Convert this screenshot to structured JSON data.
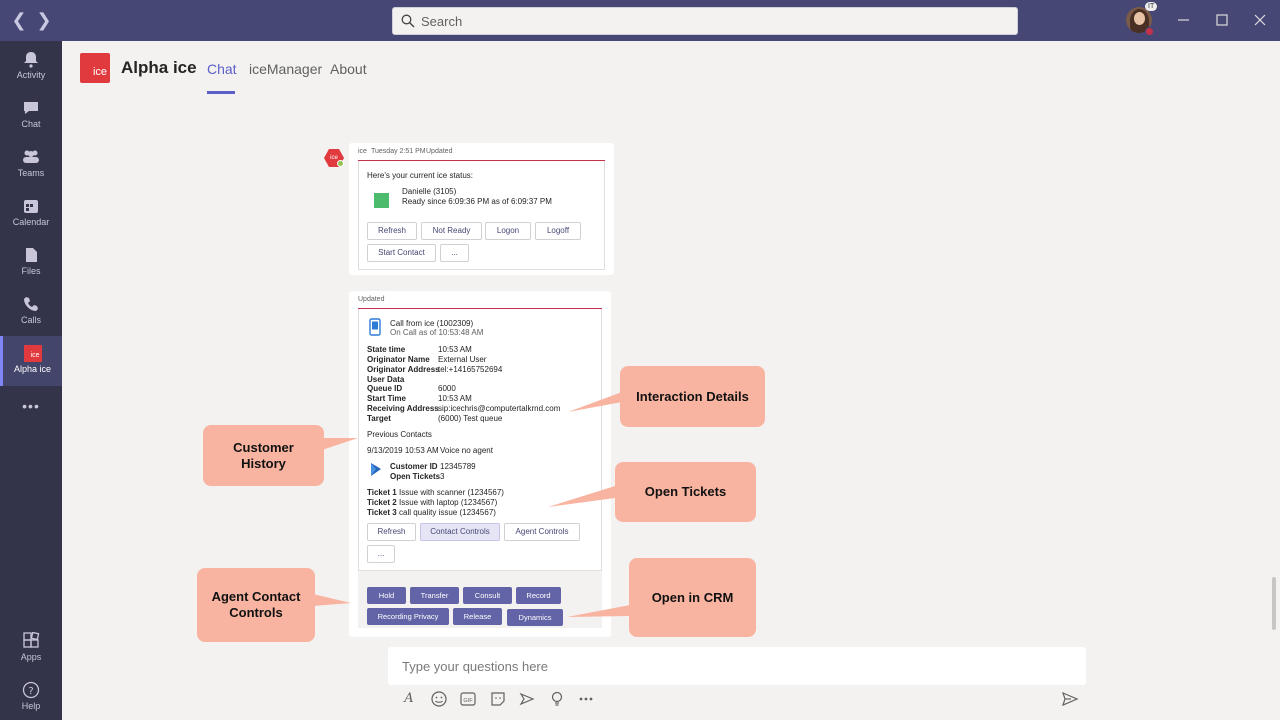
{
  "titlebar": {
    "back_glyph": "❮",
    "forward_glyph": "❯",
    "search_placeholder": "Search",
    "avatar_badge": "IT"
  },
  "rail": {
    "items": [
      {
        "label": "Activity",
        "icon": "bell-icon"
      },
      {
        "label": "Chat",
        "icon": "chat-icon"
      },
      {
        "label": "Teams",
        "icon": "teams-icon"
      },
      {
        "label": "Calendar",
        "icon": "calendar-icon"
      },
      {
        "label": "Files",
        "icon": "files-icon"
      },
      {
        "label": "Calls",
        "icon": "phone-icon"
      },
      {
        "label": "Alpha ice",
        "icon": "ice-app-icon"
      },
      {
        "label": "•••",
        "icon": "more-icon"
      },
      {
        "label": "Apps",
        "icon": "apps-icon"
      },
      {
        "label": "Help",
        "icon": "help-icon"
      }
    ],
    "ice_icon_text": "ice"
  },
  "header": {
    "logo_text": "ice",
    "title": "Alpha ice",
    "tabs": [
      "Chat",
      "iceManager",
      "About"
    ]
  },
  "card1": {
    "bot_name": "ice",
    "bot_avatar_text": "ice",
    "time": "Tuesday 2:51 PM",
    "updated": "Updated",
    "intro": "Here's your current ice status:",
    "agent": "Danielle (3105)",
    "status": "Ready since 6:09:36 PM as of 6:09:37 PM",
    "status_color": "#4cbb6c",
    "buttons": [
      "Refresh",
      "Not Ready",
      "Logon",
      "Logoff",
      "Start Contact",
      "..."
    ]
  },
  "card2": {
    "updated": "Updated",
    "call_title": "Call from ice (1002309)",
    "call_sub": "On Call as of 10:53:48 AM",
    "details": [
      {
        "k": "State time",
        "v": "10:53 AM"
      },
      {
        "k": "Originator Name",
        "v": "External User"
      },
      {
        "k": "Originator Address",
        "v": "tel:+14165752694"
      },
      {
        "k": "User Data",
        "v": ""
      },
      {
        "k": "Queue ID",
        "v": "6000"
      },
      {
        "k": "Start Time",
        "v": "10:53 AM"
      },
      {
        "k": "Receiving Address",
        "v": "sip:icechris@computertalkrnd.com"
      },
      {
        "k": "Target",
        "v": "(6000) Test queue"
      }
    ],
    "prev_label": "Previous Contacts",
    "prev_entry": "9/13/2019 10:53 AM",
    "prev_entry_desc": "Voice no agent",
    "customer_id_label": "Customer ID",
    "customer_id": "12345789",
    "open_tickets_label": "Open Tickets",
    "open_tickets": "3",
    "tickets": [
      {
        "k": "Ticket 1",
        "v": "Issue with scanner (1234567)"
      },
      {
        "k": "Ticket 2",
        "v": "Issue with laptop (1234567)"
      },
      {
        "k": "Ticket 3",
        "v": "call quality issue (1234567)"
      }
    ],
    "buttons": [
      "Refresh",
      "Contact Controls",
      "Agent Controls",
      "..."
    ],
    "actions": [
      "Hold",
      "Transfer",
      "Consult",
      "Record",
      "Recording Privacy",
      "Release",
      "Dynamics"
    ]
  },
  "callouts": {
    "interaction": "Interaction Details",
    "history": "Customer History",
    "tickets": "Open Tickets",
    "agent_controls": "Agent Contact Controls",
    "crm": "Open in CRM",
    "color": "#f8b4a0"
  },
  "compose": {
    "placeholder": "Type your questions here"
  }
}
